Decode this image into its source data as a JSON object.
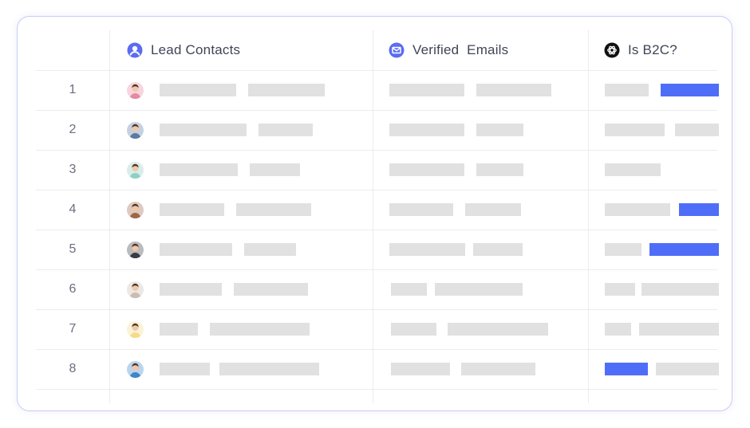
{
  "columns": [
    {
      "label": "Lead Contacts",
      "icon": "person-icon"
    },
    {
      "label": "Verified  Emails",
      "icon": "envelope-icon"
    },
    {
      "label": "Is B2C?",
      "icon": "openai-icon"
    }
  ],
  "rows": [
    {
      "index": "1",
      "avatar_color": "#e58aa2"
    },
    {
      "index": "2",
      "avatar_color": "#5b7aa3"
    },
    {
      "index": "3",
      "avatar_color": "#8fcfc4"
    },
    {
      "index": "4",
      "avatar_color": "#a0674a"
    },
    {
      "index": "5",
      "avatar_color": "#3b3b46"
    },
    {
      "index": "6",
      "avatar_color": "#c9bdb3"
    },
    {
      "index": "7",
      "avatar_color": "#f3dc8a"
    },
    {
      "index": "8",
      "avatar_color": "#3c86c9"
    }
  ],
  "colors": {
    "border": "#c9cbf5",
    "accent": "#4f6ef7",
    "placeholder": "#e1e1e1",
    "gridline": "#ececee"
  }
}
